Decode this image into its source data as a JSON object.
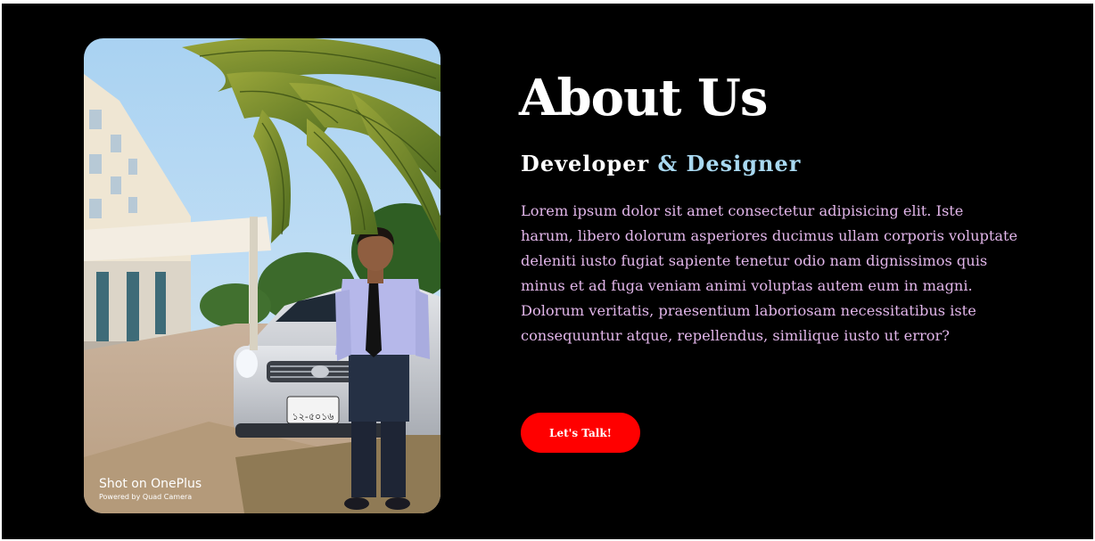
{
  "about": {
    "title": "About Us",
    "subtitle_part1": "Developer ",
    "subtitle_part2": "& Designer",
    "description": "Lorem ipsum dolor sit amet consectetur adipisicing elit. Iste harum, libero dolorum asperiores ducimus ullam corporis voluptate deleniti iusto fugiat sapiente tenetur odio nam dignissimos quis minus et ad fuga veniam animi voluptas autem eum in magni. Dolorum veritatis, praesentium laboriosam necessitatibus iste consequuntur atque, repellendus, similique iusto ut error?",
    "cta_label": "Let's Talk!"
  },
  "photo": {
    "watermark": "Shot on OnePlus",
    "watermark_sub": "Powered by Quad Camera",
    "plate_text": "১২-৫০১৬"
  },
  "colors": {
    "background": "#000000",
    "title": "#ffffff",
    "accent": "#a8d8f0",
    "paragraph": "#e2b6ea",
    "button": "#ff0000"
  }
}
